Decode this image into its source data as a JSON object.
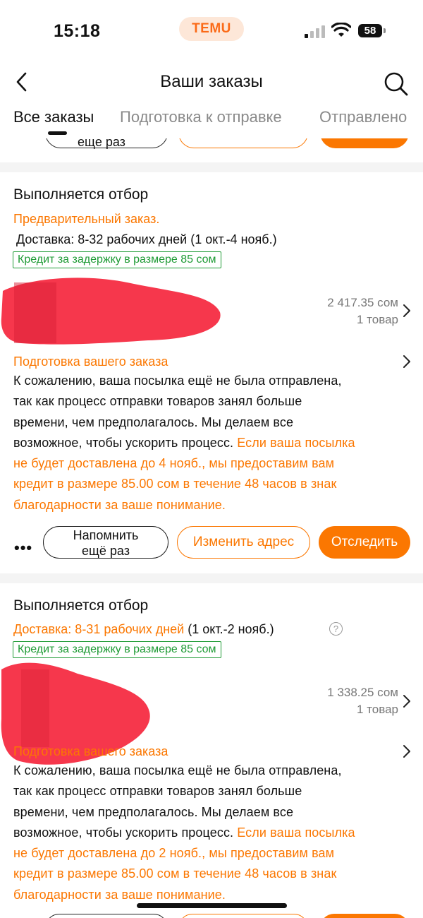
{
  "status_bar": {
    "time": "15:18",
    "brand": "TEMU",
    "battery": "58",
    "brand_color": "#fb6a17"
  },
  "header": {
    "title": "Ваши заказы",
    "back_icon": "chevron-left-icon",
    "search_icon": "search-icon"
  },
  "tabs": [
    {
      "label": "Все заказы",
      "active": true
    },
    {
      "label": "Подготовка к отправке",
      "active": false
    },
    {
      "label": "Отправлено",
      "active": false
    }
  ],
  "previous_card": {
    "remind_label_partial": "ещё раз"
  },
  "orders": [
    {
      "status": "Выполняется отбор",
      "preorder": "Предварительный заказ.",
      "delivery": "Доставка: 8-32 рабочих дней (1 окт.-4 нояб.)",
      "credit_badge": "Кредит за задержку в размере 85 сом",
      "price": "2 417.35 сом",
      "qty": "1 товар",
      "prep_title": "Подготовка вашего заказа",
      "message_lines": [
        "К сожалению, ваша посылка ещё не была отправлена,",
        "так как процесс отправки товаров занял больше",
        "времени, чем предполагалось. Мы делаем все",
        "возможное, чтобы ускорить процесс."
      ],
      "message_highlight_start": "Если ваша посылка",
      "message_highlight_lines": [
        "не будет доставлена до 4 нояб., мы предоставим вам",
        "кредит в размере 85.00 сом в течение 48 часов в знак",
        "благодарности за ваше понимание."
      ],
      "more_label": "•••",
      "remind_label_1": "Напомнить",
      "remind_label_2": "ещё раз",
      "change_address_label": "Изменить адрес",
      "track_label": "Отследить"
    },
    {
      "status": "Выполняется отбор",
      "delivery_orange": "Доставка: 8-31 рабочих дней",
      "delivery_dates": "(1 окт.-2 нояб.)",
      "help_icon": "?",
      "credit_badge": "Кредит за задержку в размере 85 сом",
      "price": "1 338.25 сом",
      "qty": "1 товар",
      "prep_title": "Подготовка вашего заказа",
      "message_lines": [
        "К сожалению, ваша посылка ещё не была отправлена,",
        "так как процесс отправки товаров занял больше",
        "времени, чем предполагалось. Мы делаем все",
        "возможное, чтобы ускорить процесс."
      ],
      "message_highlight_start": "Если ваша посылка",
      "message_highlight_lines": [
        "не будет доставлена до 2 нояб., мы предоставим вам",
        "кредит в размере 85.00 сом в течение 48 часов в знак",
        "благодарности за ваше понимание."
      ]
    }
  ],
  "colors": {
    "accent": "#fb7701",
    "credit_green": "#1f9b35",
    "divider": "#f4f4f4",
    "redaction": "#f5263d"
  }
}
